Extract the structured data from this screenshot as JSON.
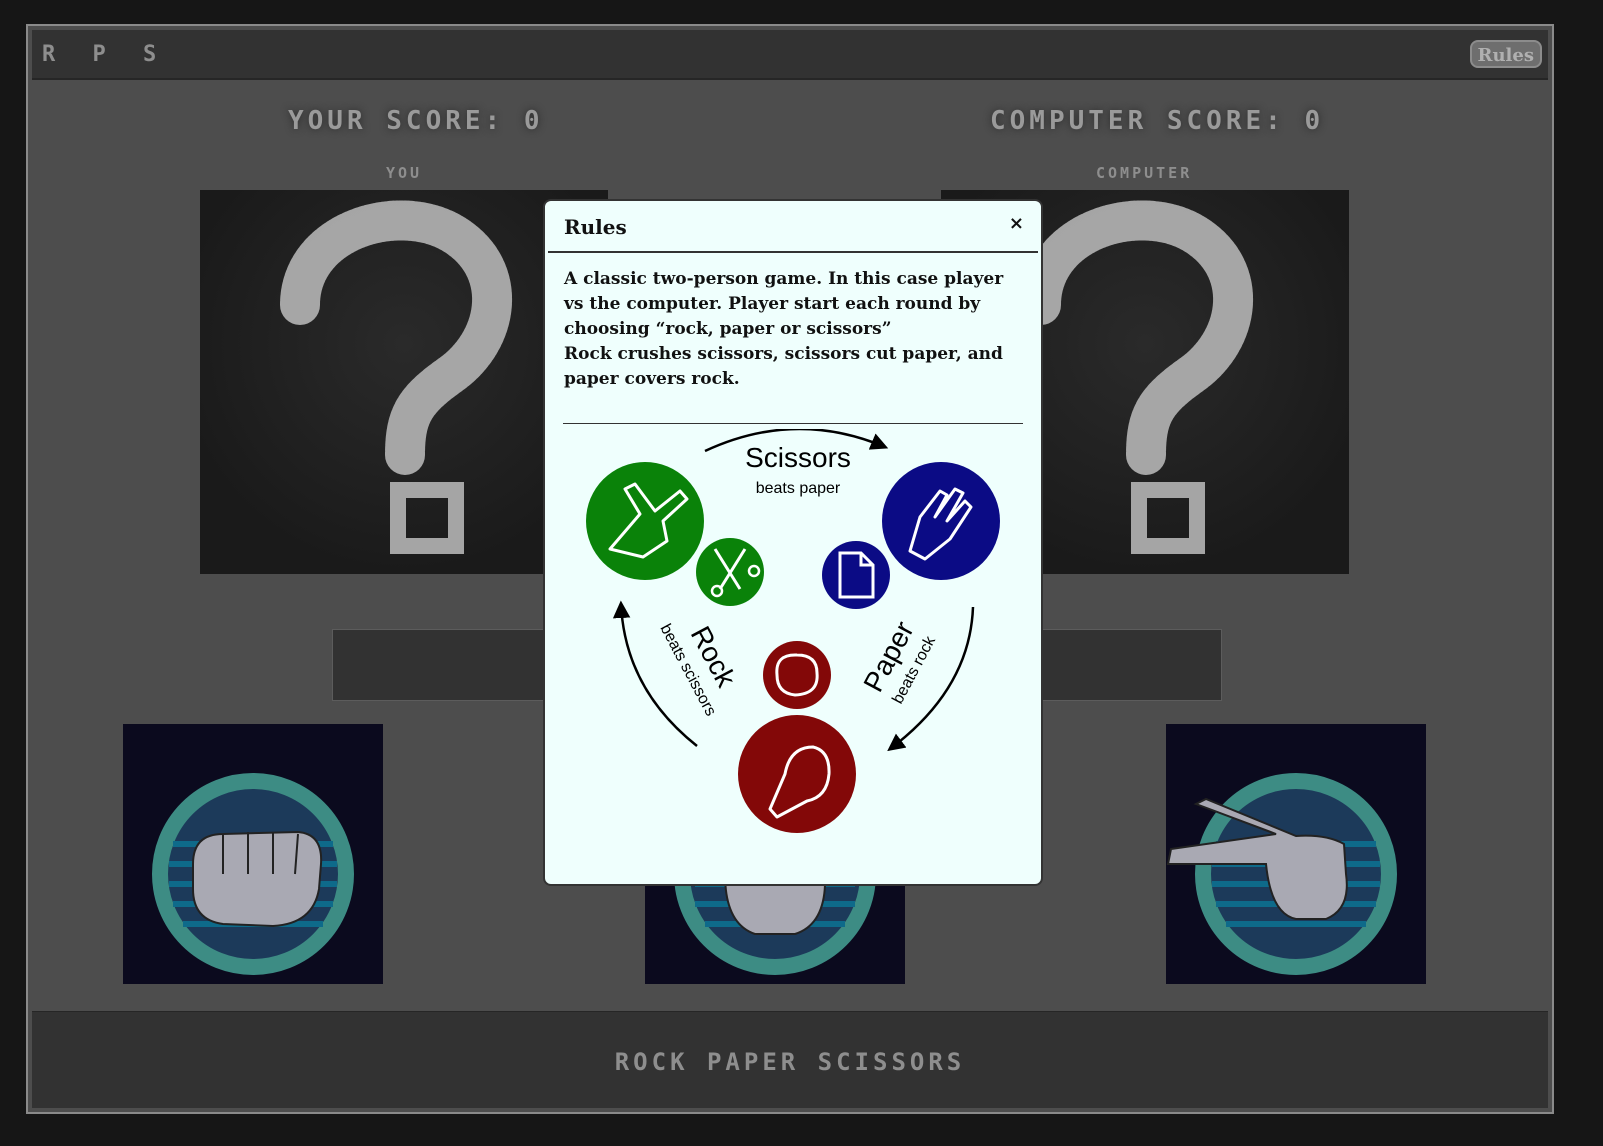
{
  "header": {
    "brand": "R P S",
    "rules_button": "Rules"
  },
  "scores": {
    "player": "YOUR SCORE: 0",
    "computer": "COMPUTER SCORE: 0"
  },
  "labels": {
    "player": "YOU",
    "computer": "COMPUTER"
  },
  "choices": [
    {
      "name": "rock",
      "icon": "fist-icon"
    },
    {
      "name": "paper",
      "icon": "open-hand-icon"
    },
    {
      "name": "scissors",
      "icon": "victory-hand-icon"
    }
  ],
  "footer": {
    "title": "ROCK PAPER SCISSORS"
  },
  "modal": {
    "title": "Rules",
    "close": "×",
    "paragraph1": "A classic two-person game. In this case player vs the computer. Player start each round by choosing “rock, paper or scissors”",
    "paragraph2": "Rock crushes scissors, scissors cut paper, and paper covers rock.",
    "diagram": {
      "scissors_label": "Scissors",
      "scissors_sub": "beats paper",
      "rock_label": "Rock",
      "rock_sub": "beats scissors",
      "paper_label": "Paper",
      "paper_sub": "beats rock"
    }
  },
  "colors": {
    "scissors": "#0a8209",
    "paper": "#0b0b85",
    "rock": "#830808",
    "choice_ring": "#3d8c84",
    "choice_bg": "#0b0a1e"
  }
}
